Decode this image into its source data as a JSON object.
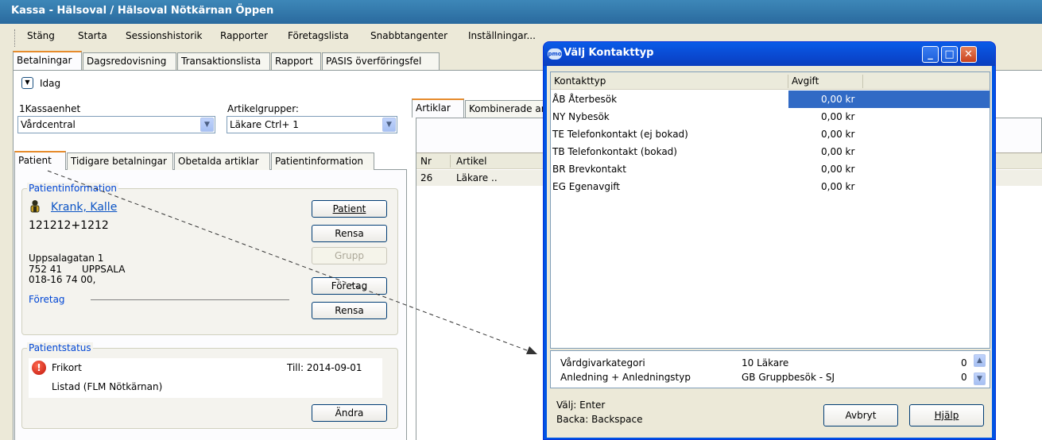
{
  "window": {
    "title": "Kassa - Hälsoval / Hälsoval Nötkärnan Öppen"
  },
  "menu": [
    "Stäng",
    "Starta",
    "Sessionshistorik",
    "Rapporter",
    "Företagslista",
    "Snabbtangenter",
    "Inställningar..."
  ],
  "main_tabs": [
    "Betalningar",
    "Dagsredovisning",
    "Transaktionslista",
    "Rapport",
    "PASIS överföringsfel"
  ],
  "today_label": "Idag",
  "kassaenhet": {
    "label": "1Kassaenhet",
    "value": "Vårdcentral"
  },
  "artikelgrupper": {
    "label": "Artikelgrupper:",
    "value": "Läkare Ctrl+ 1"
  },
  "patient_tabs": [
    "Patient",
    "Tidigare betalningar",
    "Obetalda artiklar",
    "Patientinformation"
  ],
  "patientinfo": {
    "legend": "Patientinformation",
    "name": "Krank, Kalle",
    "personnummer": "121212+1212",
    "address": "Uppsalagatan 1",
    "postnr": "752 41",
    "city": "UPPSALA",
    "phone": "018-16 74 00,",
    "foretag_label": "Företag",
    "buttons": {
      "patient": "Patient",
      "rensa1": "Rensa",
      "grupp": "Grupp",
      "foretag": "Företag",
      "rensa2": "Rensa"
    }
  },
  "patientstatus": {
    "legend": "Patientstatus",
    "frikort": "Frikort",
    "till": "Till: 2014-09-01",
    "listad": "Listad (FLM Nötkärnan)",
    "andra": "Ändra"
  },
  "articles": {
    "tabs": [
      "Artiklar",
      "Kombinerade ar"
    ],
    "headers": {
      "nr": "Nr",
      "artikel": "Artikel"
    },
    "rows": [
      {
        "nr": "26",
        "artikel": "Läkare .."
      }
    ]
  },
  "dialog": {
    "title": "Välj Kontakttyp",
    "headers": {
      "kontakttyp": "Kontakttyp",
      "avgift": "Avgift"
    },
    "rows": [
      {
        "kontakttyp": "ÅB Återbesök",
        "avgift": "0,00 kr"
      },
      {
        "kontakttyp": "NY Nybesök",
        "avgift": "0,00 kr"
      },
      {
        "kontakttyp": "TE Telefonkontakt (ej bokad)",
        "avgift": "0,00 kr"
      },
      {
        "kontakttyp": "TB Telefonkontakt (bokad)",
        "avgift": "0,00 kr"
      },
      {
        "kontakttyp": "BR Brevkontakt",
        "avgift": "0,00 kr"
      },
      {
        "kontakttyp": "EG Egenavgift",
        "avgift": "0,00 kr"
      }
    ],
    "bottom_rows": [
      {
        "label": "Vårdgivarkategori",
        "value": "10 Läkare",
        "count": "0"
      },
      {
        "label": "Anledning + Anledningstyp",
        "value": "GB Gruppbesök - SJ",
        "count": "0"
      }
    ],
    "hints": {
      "valj": "Välj: Enter",
      "backa": "Backa: Backspace"
    },
    "buttons": {
      "avbryt": "Avbryt",
      "hjalp": "Hjälp"
    },
    "icon_label": "pmo"
  }
}
